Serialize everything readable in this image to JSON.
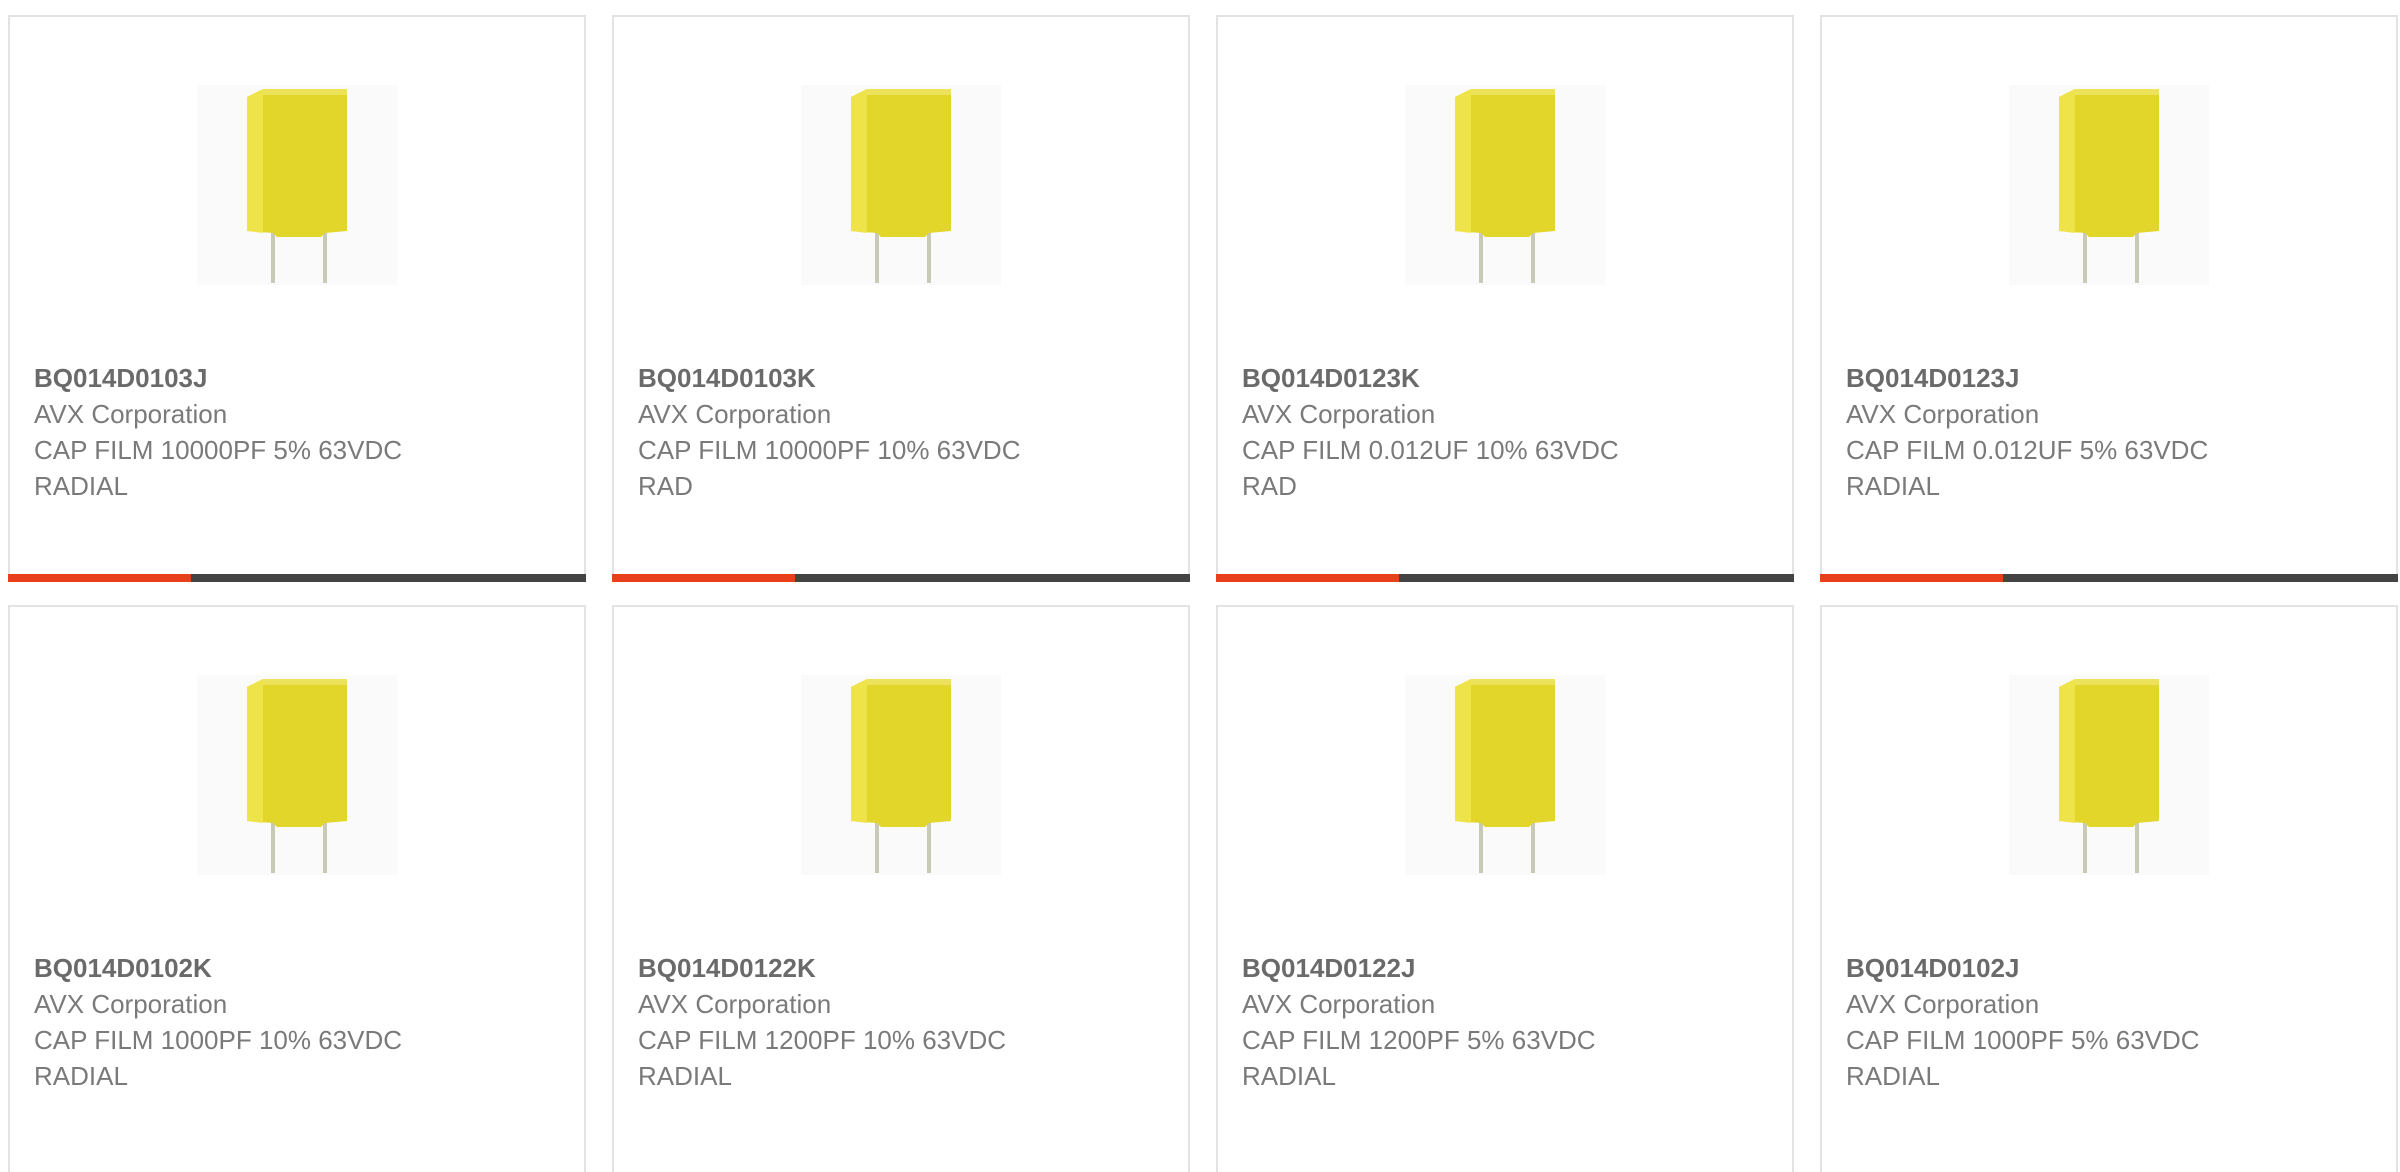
{
  "colors": {
    "accent": "#e8401c",
    "track": "#444444",
    "border": "#e3e3e3",
    "capacitor": "#e2d62a"
  },
  "products": [
    {
      "part_number": "BQ014D0103J",
      "manufacturer": "AVX Corporation",
      "description_line1": "CAP FILM 10000PF 5% 63VDC",
      "description_line2": "RADIAL",
      "image": "yellow-film-capacitor-image",
      "has_bar": true
    },
    {
      "part_number": "BQ014D0103K",
      "manufacturer": "AVX Corporation",
      "description_line1": "CAP FILM 10000PF 10% 63VDC",
      "description_line2": "RAD",
      "image": "yellow-film-capacitor-image",
      "has_bar": true
    },
    {
      "part_number": "BQ014D0123K",
      "manufacturer": "AVX Corporation",
      "description_line1": "CAP FILM 0.012UF 10% 63VDC",
      "description_line2": "RAD",
      "image": "yellow-film-capacitor-image",
      "has_bar": true
    },
    {
      "part_number": "BQ014D0123J",
      "manufacturer": "AVX Corporation",
      "description_line1": "CAP FILM 0.012UF 5% 63VDC",
      "description_line2": "RADIAL",
      "image": "yellow-film-capacitor-image",
      "has_bar": true
    },
    {
      "part_number": "BQ014D0102K",
      "manufacturer": "AVX Corporation",
      "description_line1": "CAP FILM 1000PF 10% 63VDC",
      "description_line2": "RADIAL",
      "image": "yellow-film-capacitor-image",
      "has_bar": false
    },
    {
      "part_number": "BQ014D0122K",
      "manufacturer": "AVX Corporation",
      "description_line1": "CAP FILM 1200PF 10% 63VDC",
      "description_line2": "RADIAL",
      "image": "yellow-film-capacitor-image",
      "has_bar": false
    },
    {
      "part_number": "BQ014D0122J",
      "manufacturer": "AVX Corporation",
      "description_line1": "CAP FILM 1200PF 5% 63VDC",
      "description_line2": "RADIAL",
      "image": "yellow-film-capacitor-image",
      "has_bar": false
    },
    {
      "part_number": "BQ014D0102J",
      "manufacturer": "AVX Corporation",
      "description_line1": "CAP FILM 1000PF 5% 63VDC",
      "description_line2": "RADIAL",
      "image": "yellow-film-capacitor-image",
      "has_bar": false
    }
  ]
}
